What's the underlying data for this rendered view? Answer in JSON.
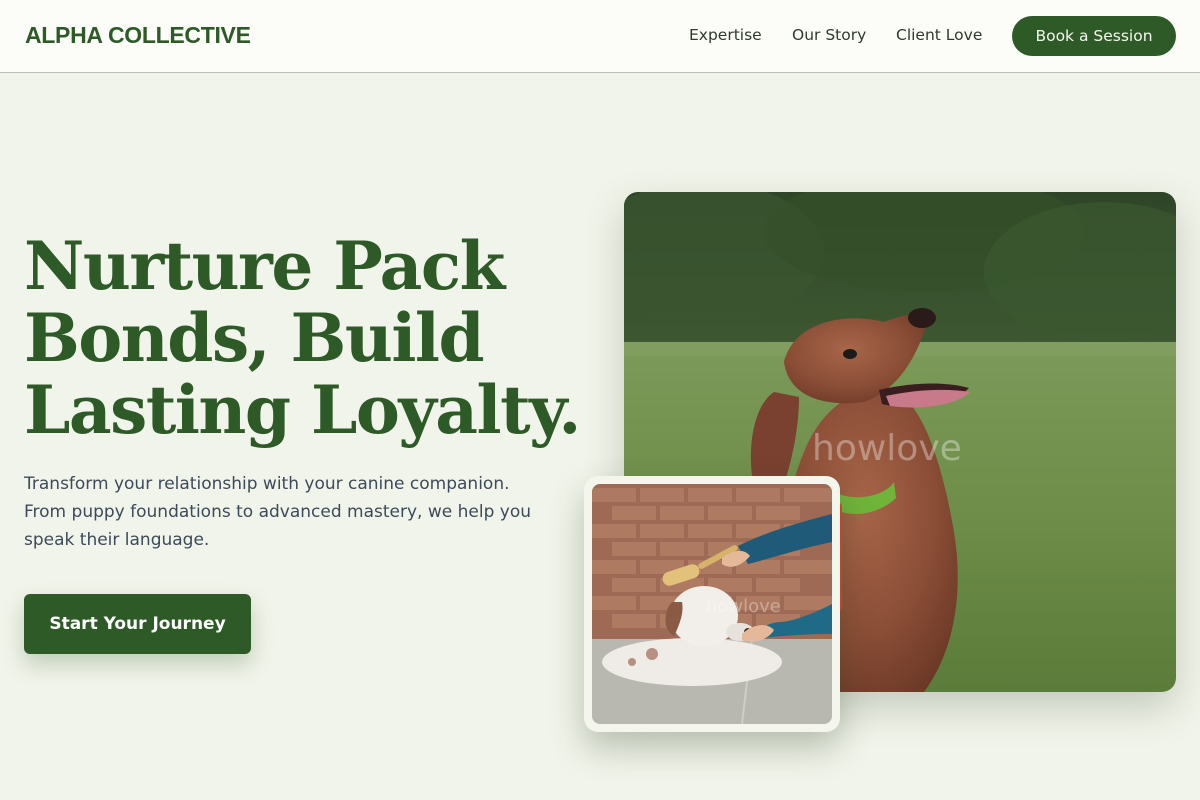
{
  "header": {
    "logo": "ALPHA COLLECTIVE",
    "nav": [
      "Expertise",
      "Our Story",
      "Client Love"
    ],
    "book_label": "Book a Session"
  },
  "hero": {
    "headline_lines": [
      "Nurture Pack",
      "Bonds, Build",
      "Lasting Loyalty."
    ],
    "subtext_lines": [
      "Transform your relationship with your canine companion.",
      "From puppy foundations to advanced mastery, we help you",
      "speak their language."
    ],
    "cta_label": "Start Your Journey"
  },
  "images": {
    "main_watermark": "howlove",
    "small_watermark": "howlove"
  },
  "colors": {
    "brand_green": "#2e5a27",
    "page_bg": "#f1f4ea",
    "header_bg": "#fcfcf9",
    "body_text": "#3c4a5a"
  }
}
